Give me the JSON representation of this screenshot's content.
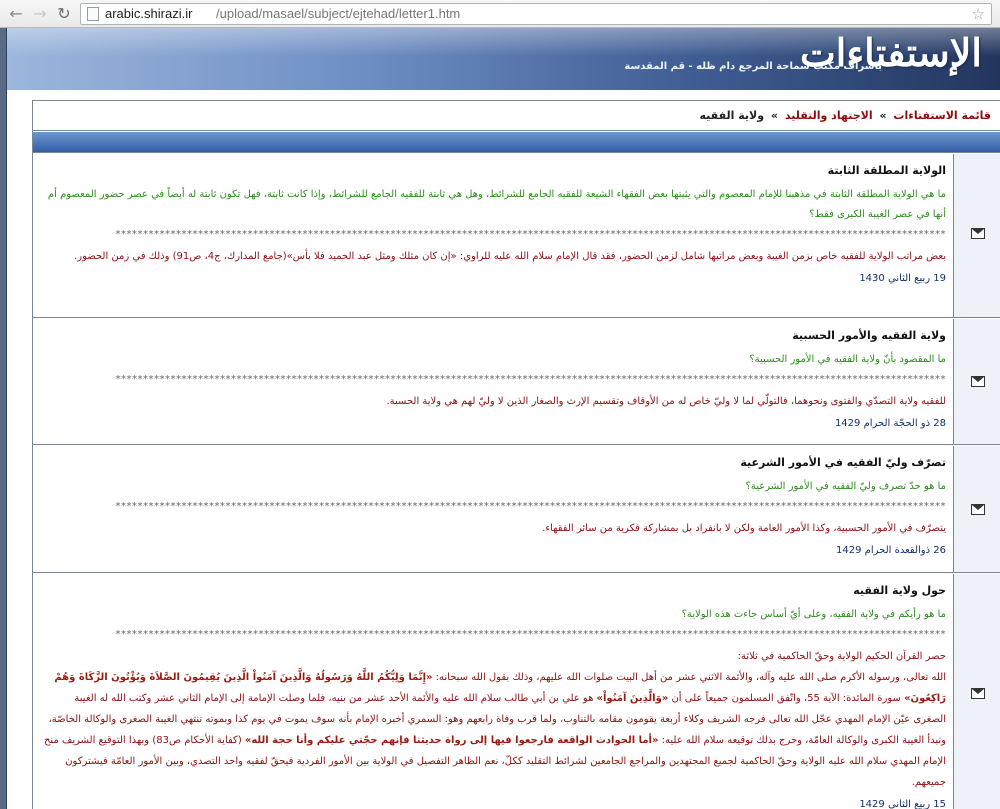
{
  "browser": {
    "url_host": "arabic.shirazi.ir",
    "url_path": "/upload/masael/subject/ejtehad/letter1.htm",
    "icons": {
      "back": "back-arrow-icon",
      "forward": "forward-arrow-icon",
      "reload": "reload-icon",
      "page": "page-icon",
      "bookmark": "star-icon"
    }
  },
  "banner": {
    "logo": "الإستفتاءات",
    "subtitle": "باشراف مكتب سماحة المرجع دام ظله - قم المقدسة"
  },
  "breadcrumb": {
    "items": [
      "قائمة الاستفتاءات",
      "الاجتهاد والتقليد",
      "ولاية الفقيه"
    ],
    "separator": "»"
  },
  "separator_line": "*******************************************************************************************************************************************************",
  "entries": [
    {
      "title": "الولاية المطلقة الثابتة",
      "question": "ما هي الولاية المطلقة الثابتة في مذهبنا للإمام المعصوم والتي يثبتها بعض الفقهاء الشيعة للفقيه الجامع للشرائط، وهل هي ثابتة للفقيه الجامع للشرائط، وإذا كانت ثابتة، فهل تكون ثابتة له أيضاً في عصر حضور المعصوم أم أنها في عصر الغيبة الكبرى فقط؟",
      "answer": "بعض مراتب الولاية للفقيه خاص بزمن الغيبة وبعض مراتبها شامل لزمن الحضور، فقد قال الإمام سلام الله عليه للراوي: «إن كان مثلك ومثل عبد الحميد فلا بأس»(جامع المدارك، ج4، ص91) وذلك في زمن الحضور.",
      "date": "19 ربيع الثاني 1430"
    },
    {
      "title": "ولاية الفقيه والأمور الحسبية",
      "question": "ما المقصود بأنّ ولاية الفقيه في الأمور الحسبية؟",
      "answer": "للفقيه ولاية التصدّي والفتوى ونحوهما، فالتولّي لما لا وليّ خاص له من الأوقاف وتقسيم الإرث والصغار الذين لا وليّ لهم هي ولاية الحسبة.",
      "date": "28 ذو الحجّة الحرام 1429"
    },
    {
      "title": "تصرّف وليّ الفقيه في الأمور الشرعية",
      "question": "ما هو حدّ تصرف وليّ الفقيه في الأمور الشرعية؟",
      "answer": "يتصرّف في الأمور الحسبية، وكذا الأمور العامة ولكن لا بانفراد بل بمشاركة فكرية من سائر الفقهاء.",
      "date": "26 ذوالقعدة الحرام 1429"
    },
    {
      "title": "حول ولاية الفقيه",
      "question": "ما هو رأيكم في ولاية الفقيه، وعلى أيّ أساس جاءت هذه الولاية؟",
      "answer_intro": "حصر القرآن الحكيم الولاية وحقّ الحاكمية في ثلاثة:",
      "answer_parts": [
        {
          "t": "الله تعالى، ورسوله الأكرم صلى الله عليه وآله، والأئمة الاثني عشر من أهل البيت صلوات الله عليهم، وذلك بقول الله سبحانه: ",
          "b": false
        },
        {
          "t": "«إِنَّمَا وَلِيُّكُمُ اللَّهُ وَرَسُولُهُ وَالَّذِينَ آمَنُواْ الَّذِينَ يُقِيمُونَ الصَّلاَةَ وَيُؤْتُونَ الزَّكَاةَ وَهُمْ رَاكِعُونَ»",
          "b": true
        },
        {
          "t": " سورة المائدة: الآية 55، واتّفق المسلمون جميعاً على أن ",
          "b": false
        },
        {
          "t": "«وَالَّذِينَ آمَنُواْ»",
          "b": true
        },
        {
          "t": " هو علي بن أبي طالب سلام الله عليه والأئمة الأحد عشر من بنيه، فلما وصلت الإمامة إلى الإمام الثاني عشر وكتب الله له الغيبة الصغرى عيّن الإمام المهدي عجّل الله تعالى فرجه الشريف وكلاء أربعة يقومون مقامه بالتناوب، ولما قرب وفاة رابعهم وهو: السمري أخبره الإمام بأنه سوف يموت في يوم كذا وبموته تنتهي الغيبة الصغرى والوكالة الخاصّة، وتبدأ الغيبة الكبرى والوكالة العامّة، وخرج بذلك توقيعه سلام الله عليه: ",
          "b": false
        },
        {
          "t": "«أما الحوادث الواقعة فارجعوا فيها إلى رواة حديثنا فإنهم حجّتي عليكم وأنا حجة الله»",
          "b": true
        },
        {
          "t": " (كفاية الأحكام ص83) وبهذا التوقيع الشريف منح الإمام المهدي سلام الله عليه الولاية وحقّ الحاكمية لجميع المجتهدين والمراجع الجامعين لشرائط التقليد ككلّ، نعم الظاهر التفصيل في الولاية بين الأمور الفردية فيحقّ لفقيه واحد التصدي، وبين الأمور العامّة فيشتركون جميعهم.",
          "b": false
        }
      ],
      "date": "15 ربيع الثاني 1429"
    }
  ]
}
